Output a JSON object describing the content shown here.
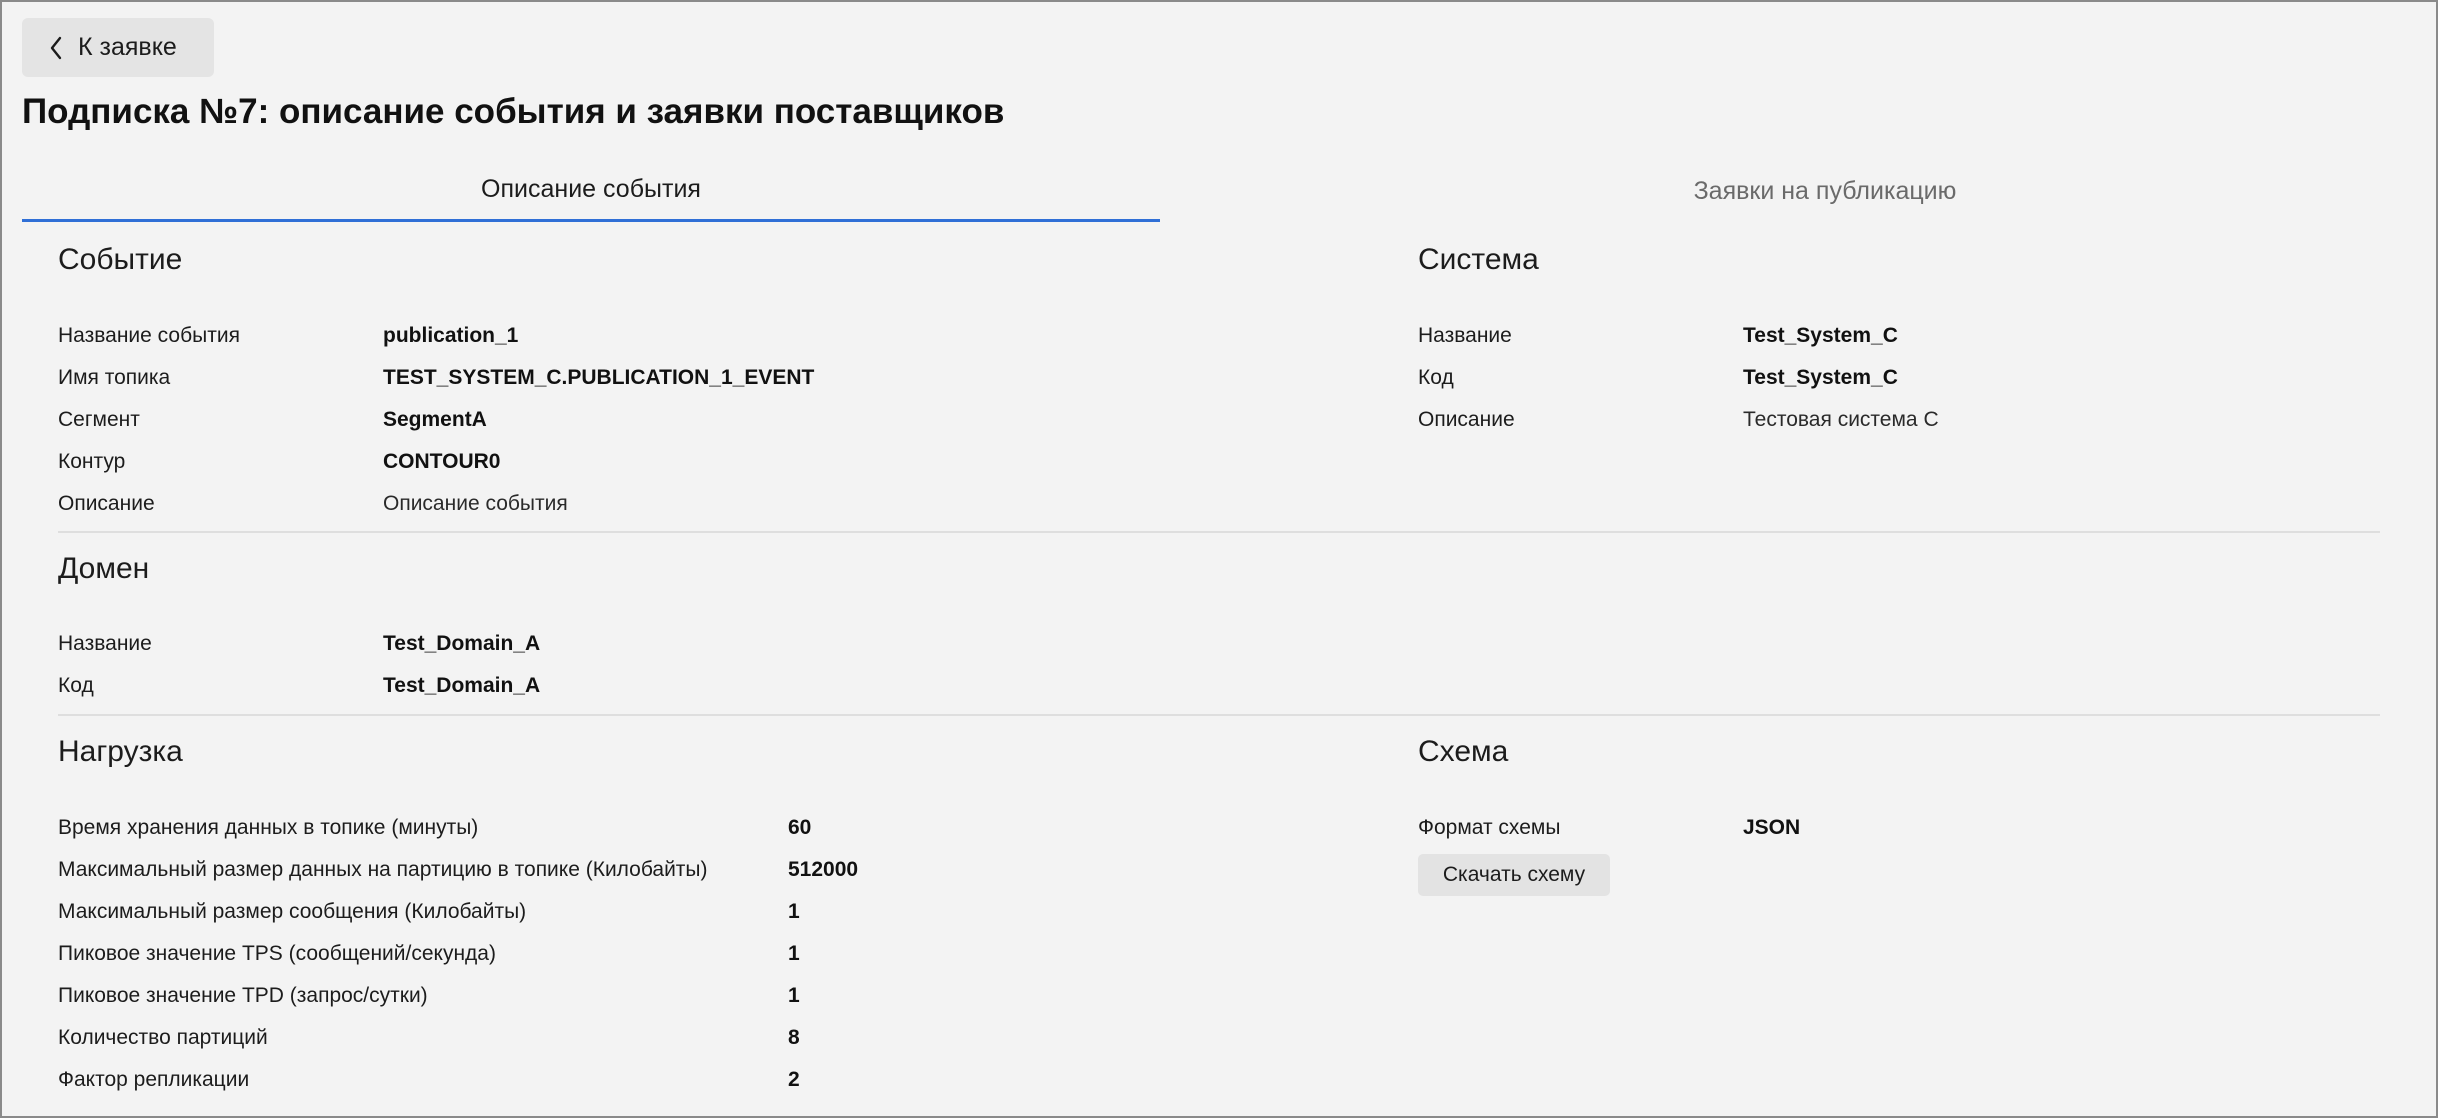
{
  "back_button": {
    "label": "К заявке",
    "icon": "chevron-left-icon"
  },
  "page_title": "Подписка №7: описание события и заявки поставщиков",
  "tabs": [
    {
      "label": "Описание события",
      "active": true
    },
    {
      "label": "Заявки на публикацию",
      "active": false
    }
  ],
  "event": {
    "title": "Событие",
    "rows": [
      {
        "label": "Название события",
        "value": "publication_1"
      },
      {
        "label": "Имя топика",
        "value": "TEST_SYSTEM_C.PUBLICATION_1_EVENT"
      },
      {
        "label": "Сегмент",
        "value": "SegmentA"
      },
      {
        "label": "Контур",
        "value": "CONTOUR0"
      },
      {
        "label": "Описание",
        "value": "Описание события"
      }
    ]
  },
  "system": {
    "title": "Система",
    "rows": [
      {
        "label": "Название",
        "value": "Test_System_C"
      },
      {
        "label": "Код",
        "value": "Test_System_C"
      },
      {
        "label": "Описание",
        "value": "Тестовая система С"
      }
    ]
  },
  "domain": {
    "title": "Домен",
    "rows": [
      {
        "label": "Название",
        "value": "Test_Domain_A"
      },
      {
        "label": "Код",
        "value": "Test_Domain_A"
      }
    ]
  },
  "load": {
    "title": "Нагрузка",
    "rows": [
      {
        "label": "Время хранения данных в топике (минуты)",
        "value": "60"
      },
      {
        "label": "Максимальный размер данных на партицию в топике (Килобайты)",
        "value": "512000"
      },
      {
        "label": "Максимальный размер сообщения (Килобайты)",
        "value": "1"
      },
      {
        "label": "Пиковое значение TPS (сообщений/секунда)",
        "value": "1"
      },
      {
        "label": "Пиковое значение TPD (запрос/сутки)",
        "value": "1"
      },
      {
        "label": "Количество партиций",
        "value": "8"
      },
      {
        "label": "Фактор репликации",
        "value": "2"
      }
    ]
  },
  "schema": {
    "title": "Схема",
    "rows": [
      {
        "label": "Формат схемы",
        "value": "JSON"
      }
    ],
    "download_label": "Скачать схему"
  },
  "colors": {
    "accent": "#2f6fd6",
    "background": "#f3f3f3",
    "button": "#e4e4e4"
  }
}
